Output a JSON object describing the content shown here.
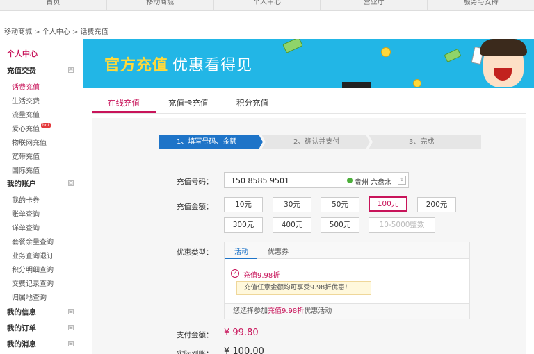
{
  "topnav": [
    "首页",
    "移动商城",
    "个人中心",
    "营业厅",
    "服务与支持"
  ],
  "breadcrumb": "移动商城 > 个人中心 > 话费充值",
  "sidebar": {
    "title": "个人中心",
    "groups": [
      {
        "label": "充值交费",
        "toggle": "⊟"
      },
      {
        "label": "我的账户",
        "toggle": "⊟"
      },
      {
        "label": "我的信息",
        "toggle": "⊞"
      },
      {
        "label": "我的订单",
        "toggle": "⊞"
      },
      {
        "label": "我的消息",
        "toggle": "⊞"
      }
    ],
    "items": [
      "话费充值",
      "生活交费",
      "流量充值",
      "爱心充值",
      "物联网充值",
      "宽带充值",
      "国际充值",
      "我的卡券",
      "账单查询",
      "详单查询",
      "套餐余量查询",
      "业务查询退订",
      "积分明细查询",
      "交费记录查询",
      "归属地查询"
    ],
    "hot_badge": "hot"
  },
  "banner": {
    "title_main": "官方充值",
    "title_sub": "优惠看得见"
  },
  "tabs": [
    "在线充值",
    "充值卡充值",
    "积分充值"
  ],
  "steps": [
    "1、填写号码、金额",
    "2、确认并支付",
    "3、完成"
  ],
  "form": {
    "phone_label": "充值号码：",
    "phone_value": "150 8585 9501",
    "location": "贵州 六盘水",
    "location_btn": "↕",
    "amount_label": "充值金额：",
    "amounts": [
      "10元",
      "30元",
      "50元",
      "100元",
      "200元",
      "300元",
      "400元",
      "500元"
    ],
    "custom_amount_placeholder": "10-5000整数",
    "discount_label": "优惠类型：",
    "discount_tabs": [
      "活动",
      "优惠券"
    ],
    "discount_name": "充值9.98折",
    "discount_tip": "充值任意金额均可享受9.98折优惠！",
    "discount_foot_pre": "您选择参加",
    "discount_foot_hl": "充值9.98折",
    "discount_foot_post": "优惠活动",
    "pay_label": "支付金额：",
    "pay_value": "¥ 99.80",
    "real_label": "实际到账：",
    "real_value": "¥ 100.00"
  },
  "colors": {
    "accent": "#c8145a",
    "step_active": "#1e74c8",
    "banner_bg": "#22b6e6"
  }
}
